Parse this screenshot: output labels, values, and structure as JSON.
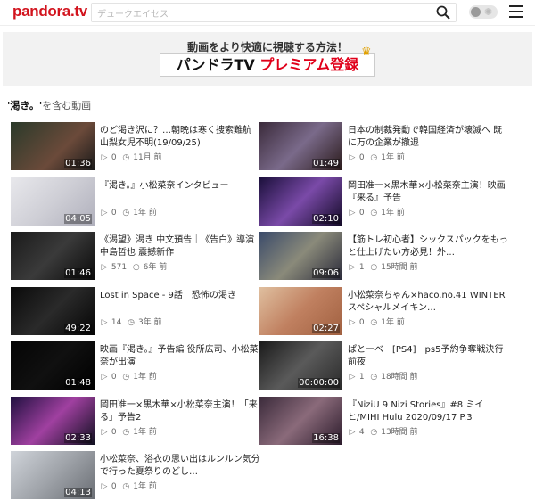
{
  "header": {
    "logo": "pandora.tv",
    "search_placeholder": "デュークエイセス",
    "accent": "#d2141e"
  },
  "banner": {
    "subtitle": "動画をより快適に視聴する方法！",
    "title_part1": "パンドラTV ",
    "title_part2": "プレミアム登録"
  },
  "section": {
    "keyword": "'渇き。'",
    "suffix": "を含む動画"
  },
  "videos": [
    {
      "title": "のど渇き沢に？…朝晩は寒く捜索難航 山梨女児不明(19/09/25)",
      "duration": "01:36",
      "plays": "0",
      "age": "11月 前"
    },
    {
      "title": "日本の制裁発動で韓国経済が壊滅へ 既に万の企業が撤退",
      "duration": "01:49",
      "plays": "0",
      "age": "1年 前"
    },
    {
      "title": "『渇き。』小松菜奈インタビュー",
      "duration": "04:05",
      "plays": "0",
      "age": "1年 前"
    },
    {
      "title": "岡田准一×黒木華×小松菜奈主演！映画『来る』予告",
      "duration": "02:10",
      "plays": "0",
      "age": "1年 前"
    },
    {
      "title": "《渴望》渴き 中文預告｜《告白》導演中島哲也 震撼新作",
      "duration": "01:46",
      "plays": "571",
      "age": "6年 前"
    },
    {
      "title": "【筋トレ初心者】シックスパックをもっと仕上げたい方必見！外…",
      "duration": "09:06",
      "plays": "1",
      "age": "15時間 前"
    },
    {
      "title": "Lost in Space - 9話　恐怖の渇き",
      "duration": "49:22",
      "plays": "14",
      "age": "3年 前"
    },
    {
      "title": "小松菜奈ちゃん×haco.no.41 WINTER スペシャルメイキン…",
      "duration": "02:27",
      "plays": "0",
      "age": "1年 前"
    },
    {
      "title": "映画『渇き。』予告編 役所広司、小松菜奈が出演",
      "duration": "01:48",
      "plays": "0",
      "age": "1年 前"
    },
    {
      "title": "ぱとーべ　[PS4]　ps5予約争奪戦決行前夜",
      "duration": "00:00:00",
      "plays": "1",
      "age": "18時間 前"
    },
    {
      "title": "岡田准一×黒木華×小松菜奈主演！「来る」予告2",
      "duration": "02:33",
      "plays": "0",
      "age": "1年 前"
    },
    {
      "title": "『NiziU 9 Nizi Stories』#8 ミイヒ/MIHI Hulu 2020/09/17 P.3",
      "duration": "16:38",
      "plays": "4",
      "age": "13時間 前"
    },
    {
      "title": "小松菜奈、浴衣の思い出はルンルン気分で行った夏祭りのどし…",
      "duration": "04:13",
      "plays": "0",
      "age": "1年 前"
    }
  ]
}
